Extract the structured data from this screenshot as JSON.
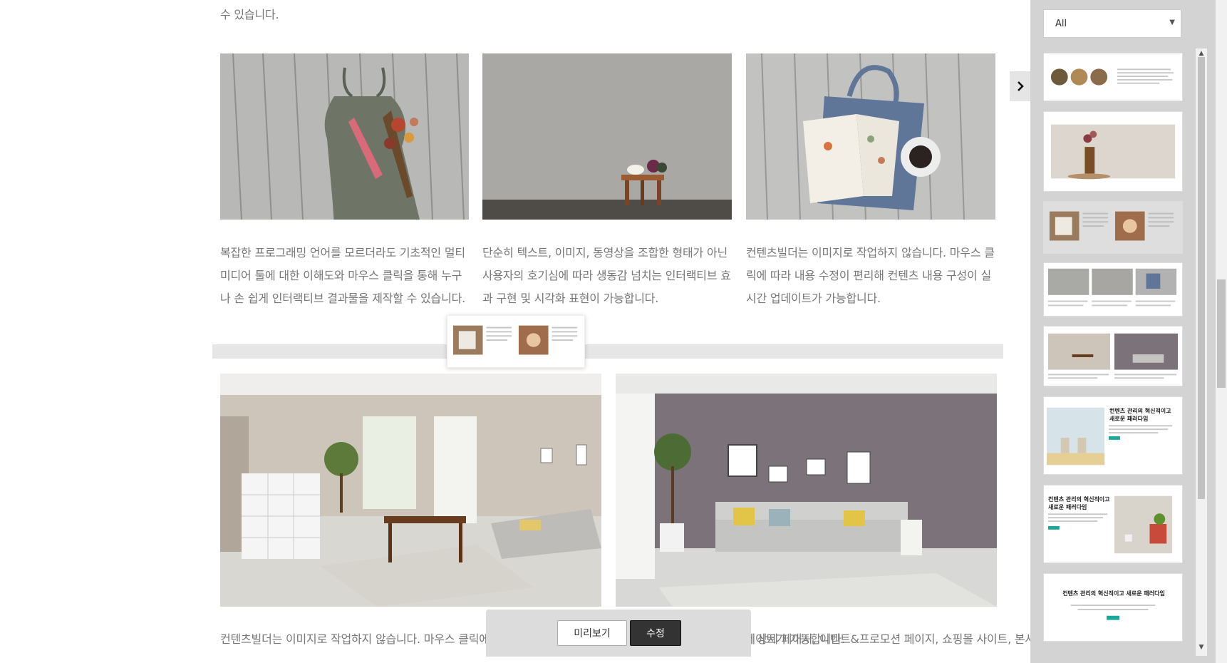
{
  "content": {
    "top_text_tail": "수 있습니다.",
    "row1": [
      {
        "text": "복잡한 프로그래밍 언어를 모르더라도 기초적인 멀티미디어 툴에 대한 이해도와 마우스 클릭을 통해 누구나 손 쉽게 인터랙티브 결과물을 제작할 수 있습니다."
      },
      {
        "text": "단순히 텍스트, 이미지, 동영상을 조합한 형태가 아닌 사용자의 호기심에 따라 생동감 넘치는 인터랙티브 효과 구현 및 시각화 표현이 가능합니다."
      },
      {
        "text": "컨텐츠빌더는 이미지로 작업하지 않습니다. 마우스 클릭에 따라 내용 수정이 편리해 컨텐츠 내용 구성이 실시간 업데이트가 가능합니다."
      }
    ],
    "row2": [
      {
        "text": "컨텐츠빌더는 이미지로 작업하지 않습니다. 마우스 클릭에 따라 내용 수정이 편리해 컨텐츠 내용구성이 실시간 업데이트가 가능합니다."
      },
      {
        "text": "브랜드 컨텐츠, 브랜드 제품의 상세 페이지, 이벤트&프로모션 페이지, 쇼핑몰 사이트, 본사·지사 및 대학교 학과의 마이크로 사이트 등을 쉽게 제작할 수 있습니다."
      }
    ]
  },
  "bottom_bar": {
    "preview_label": "미리보기",
    "edit_label": "수정"
  },
  "sidebar": {
    "filter": {
      "selected": "All"
    },
    "thumbnails": [
      {
        "id": "t1"
      },
      {
        "id": "t2"
      },
      {
        "id": "t3",
        "selected": true
      },
      {
        "id": "t4"
      },
      {
        "id": "t5"
      },
      {
        "id": "t6",
        "title": "컨텐츠 관리의 혁신적이고 새로운 패러다임"
      },
      {
        "id": "t7",
        "title": "컨텐츠 관리의 혁신적이고 새로운 패러다임"
      },
      {
        "id": "t8",
        "title": "컨텐츠 관리의 혁신적이고 새로운 패러다임"
      }
    ]
  },
  "colors": {
    "accent": "#1aa89b",
    "sidebar_bg": "#d3d3d3",
    "edit_button": "#333333"
  }
}
